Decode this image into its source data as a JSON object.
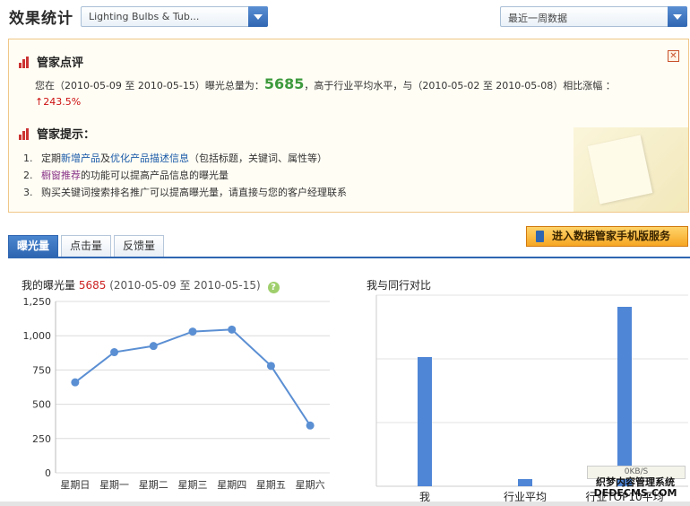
{
  "header": {
    "title": "效果统计",
    "product_select": "Lighting Bulbs & Tub...",
    "period_select": "最近一周数据"
  },
  "review": {
    "title": "管家点评",
    "summary": {
      "prefix": "您在（2010-05-09 至 2010-05-15）曝光总量为：",
      "total": "5685",
      "middle": "，高于行业平均水平，与（2010-05-02 至 2010-05-08）相比涨幅 ：",
      "growth_arrow": "↑",
      "growth": "243.5%"
    },
    "tips_title": "管家提示：",
    "tips": [
      {
        "num": "1.",
        "pre": "定期",
        "link1": "新增产品",
        "mid": "及",
        "link2": "优化产品描述信息",
        "post": "（包括标题，关键词、属性等）"
      },
      {
        "num": "2.",
        "link1": "橱窗推荐",
        "post": "的功能可以提高产品信息的曝光量"
      },
      {
        "num": "3.",
        "text": "购买关键词搜索排名推广可以提高曝光量，请直接与您的客户经理联系"
      }
    ],
    "close_icon": "close-icon"
  },
  "tabs": [
    "曝光量",
    "点击量",
    "反馈量"
  ],
  "mobile_button": "进入数据管家手机版服务",
  "line_chart_title": {
    "label": "我的曝光量",
    "total": "5685",
    "range": "(2010-05-09 至 2010-05-15)",
    "help": "?"
  },
  "bar_chart_title": "我与同行对比",
  "chart_data": [
    {
      "type": "line",
      "categories": [
        "星期日",
        "星期一",
        "星期二",
        "星期三",
        "星期四",
        "星期五",
        "星期六"
      ],
      "values": [
        660,
        880,
        925,
        1030,
        1045,
        780,
        345
      ],
      "ylim": [
        0,
        1250
      ],
      "yticks": [
        0,
        250,
        500,
        750,
        1000,
        1250
      ],
      "ytick_labels": [
        "0",
        "250",
        "500",
        "750",
        "1,000",
        "1,250"
      ],
      "grid": true,
      "color": "#5b8fd3"
    },
    {
      "type": "bar",
      "categories": [
        "我",
        "行业平均",
        "行业TOP10平均"
      ],
      "values": [
        0.72,
        0.04,
        1.0
      ],
      "color": "#4f86d6",
      "grid": true
    }
  ],
  "watermark": {
    "bar": "0KB/S",
    "line1": "织梦内容管理系统",
    "line2": "DEDECMS.COM"
  }
}
